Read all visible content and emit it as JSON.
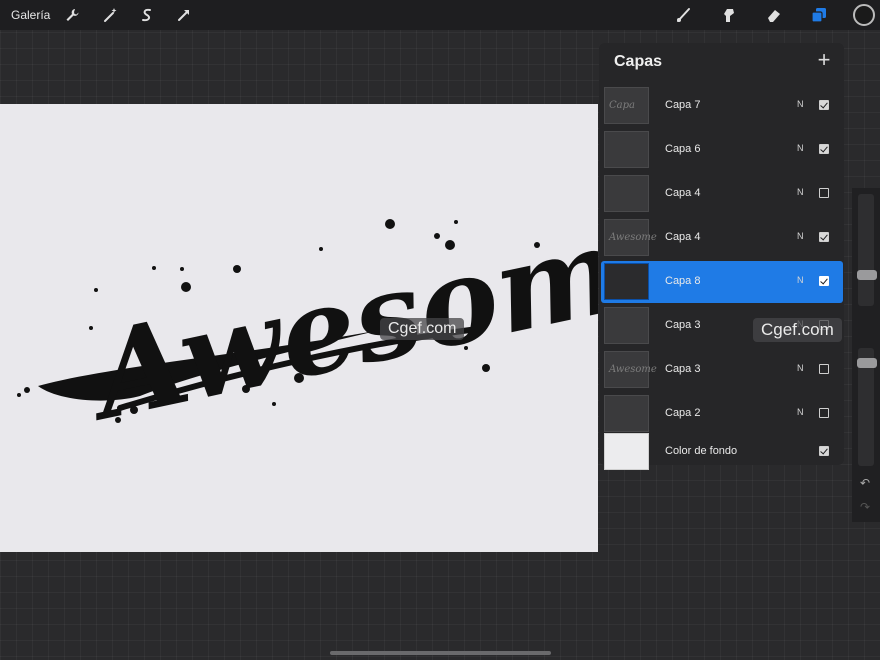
{
  "toolbar": {
    "gallery_label": "Galería",
    "left_tools": [
      "wrench-icon",
      "magic-wand-icon",
      "selection-icon",
      "transform-icon"
    ],
    "right_tools": [
      "brush-icon",
      "smudge-icon",
      "eraser-icon",
      "layers-icon"
    ],
    "current_color": "#1a1a1a",
    "accent": "#1f7be6"
  },
  "canvas": {
    "artwork_text": "Awesome",
    "background": "#e9e8ec",
    "ink": "#111111"
  },
  "layers_panel": {
    "title": "Capas",
    "add_label": "+",
    "layers": [
      {
        "name": "Capa 7",
        "blend": "N",
        "visible": true,
        "selected": false,
        "thumb": "Capa"
      },
      {
        "name": "Capa 6",
        "blend": "N",
        "visible": true,
        "selected": false,
        "thumb": ""
      },
      {
        "name": "Capa 4",
        "blend": "N",
        "visible": false,
        "selected": false,
        "thumb": ""
      },
      {
        "name": "Capa 4",
        "blend": "N",
        "visible": true,
        "selected": false,
        "thumb": "Awesome"
      },
      {
        "name": "Capa 8",
        "blend": "N",
        "visible": true,
        "selected": true,
        "thumb": ""
      },
      {
        "name": "Capa 3",
        "blend": "N",
        "visible": false,
        "selected": false,
        "thumb": ""
      },
      {
        "name": "Capa 3",
        "blend": "N",
        "visible": false,
        "selected": false,
        "thumb": "Awesome"
      },
      {
        "name": "Capa 2",
        "blend": "N",
        "visible": false,
        "selected": false,
        "thumb": ""
      }
    ],
    "background_layer": {
      "name": "Color de fondo",
      "visible": true
    }
  },
  "sidebar": {
    "undo_icon": "↶",
    "redo_icon": "↷"
  },
  "watermarks": [
    "Cgef.com",
    "Cgef.com"
  ]
}
